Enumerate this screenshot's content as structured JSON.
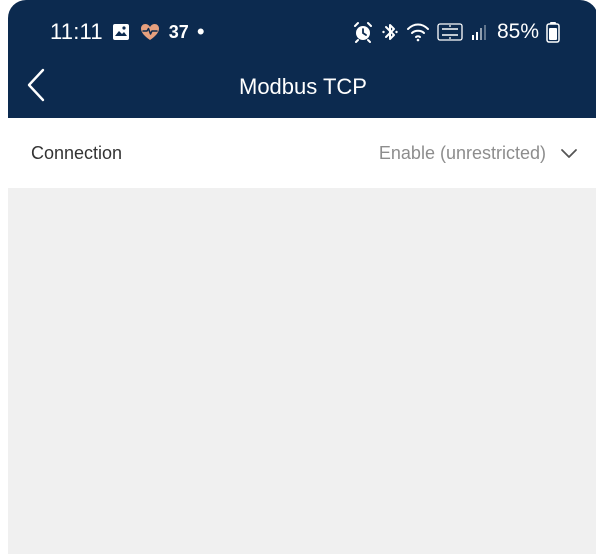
{
  "status_bar": {
    "time": "11:11",
    "health_count": "37",
    "separator": "•",
    "battery_percent": "85%"
  },
  "header": {
    "title": "Modbus TCP"
  },
  "settings": {
    "connection_label": "Connection",
    "connection_value": "Enable (unrestricted)"
  },
  "icons": {
    "photo": "image-icon",
    "health": "heart-icon",
    "alarm": "alarm-clock-icon",
    "bluetooth": "bluetooth-icon",
    "wifi": "wifi-icon",
    "network": "volte-lte-icon",
    "signal": "signal-icon",
    "battery": "battery-icon",
    "back": "chevron-left-icon",
    "dropdown": "chevron-down-icon"
  },
  "colors": {
    "header_background": "#0c2a4f",
    "page_background": "#f0f0f0",
    "row_background": "#ffffff",
    "health_icon": "#e7a07e"
  }
}
